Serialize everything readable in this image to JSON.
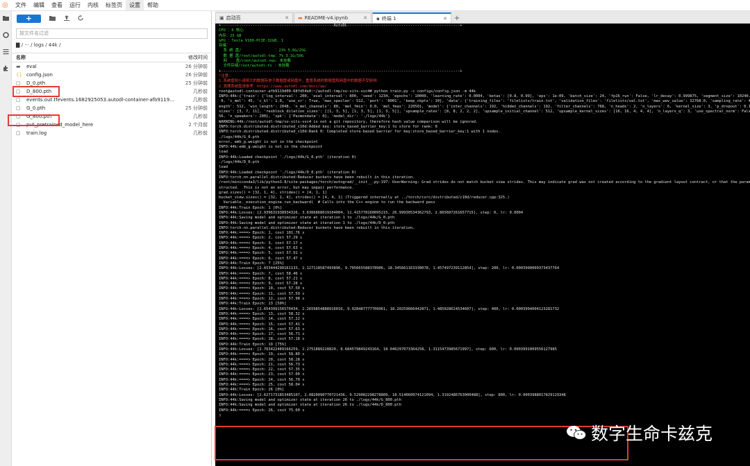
{
  "menubar": {
    "items": [
      "文件",
      "编辑",
      "查看",
      "运行",
      "内核",
      "标签页",
      "设置",
      "帮助"
    ],
    "active": "设置"
  },
  "filebrowser": {
    "search_placeholder": "按文件名过滤",
    "breadcrumb": "▇ / ··· / logs / 44k /",
    "col_name": "名称",
    "col_modified": "修改时间",
    "files": [
      {
        "name": "eval",
        "modified": "26 分钟前",
        "icon": "folder"
      },
      {
        "name": "config.json",
        "modified": "26 分钟前",
        "icon": "json"
      },
      {
        "name": "D_0.pth",
        "modified": "25 分钟前",
        "icon": "file"
      },
      {
        "name": "D_800.pth",
        "modified": "几秒前",
        "icon": "file"
      },
      {
        "name": "events.out.tfevents.1682925053.autodl-container-afb9119d00-...",
        "modified": "几秒前",
        "icon": "file"
      },
      {
        "name": "G_0.pth",
        "modified": "25 分钟前",
        "icon": "file"
      },
      {
        "name": "G_800.pth",
        "modified": "几秒前",
        "icon": "file"
      },
      {
        "name": "put_pretrained_model_here",
        "modified": "2 个月前",
        "icon": "file"
      },
      {
        "name": "train.log",
        "modified": "几秒前",
        "icon": "file"
      }
    ]
  },
  "tabs": [
    {
      "label": "启动页",
      "active": false
    },
    {
      "label": "README-v4.ipynb",
      "active": false
    },
    {
      "label": "终端 1",
      "active": true
    }
  ],
  "terminal": {
    "lines": [
      {
        "t": "+--------------------------------------------------AutoDL--------------------------------------------------+",
        "c": ""
      },
      {
        "t": "CPU ：6 核心",
        "c": "g"
      },
      {
        "t": "内存：25 GB",
        "c": "g"
      },
      {
        "t": "GPU ：Tesla V100-PCIE-32GB, 1",
        "c": "g"
      },
      {
        "t": "存储：",
        "c": "g"
      },
      {
        "t": "  系 统 盘/               ：23% 5.6G/25G",
        "c": "g"
      },
      {
        "t": "  数 据 盘/root/autodl-tmp：7% 3.1G/50G",
        "c": "g"
      },
      {
        "t": "  网    盘/root/autodl-nas：未挂载",
        "c": "g"
      },
      {
        "t": "  文件存储/root/autodl-fs ：未挂载",
        "c": "g"
      },
      {
        "t": "+----------------------------------------------------------------------------------------------------------+",
        "c": ""
      },
      {
        "t": "*注意：",
        "c": "r"
      },
      {
        "t": "1.系统盘较小请将大的数据存放于数据盘或网盘中，重置系统时数据盘和网盘中的数据不受影响",
        "c": "r"
      },
      {
        "t": "2.清理系统盘请参考：https://www.autodl.com/docs/qa/",
        "c": "r"
      },
      {
        "t": "root@autodl-container-afb9119d00-68fd54e0:~/autodl-tmp/so-vits-svc4# python train.py -c configs/config.json -m 44k",
        "c": ""
      },
      {
        "t": "INFO:44k:{'train': {'log_interval': 200, 'eval_interval': 800, 'seed': 1234, 'epochs': 10000, 'learning_rate': 0.0004, 'betas': [0.8, 0.99], 'eps': 1e-09, 'batch_size': 24, 'fp16_run': False, 'lr_decay': 0.999875, 'segment_size': 10240, 'init_lr_ratio': 1, 'warmup_epochs': 0, 'c_mel': 45, 'c_kl': 1.0,",
        "c": ""
      },
      {
        "t": " 0, 'c_mel': 45, 'c_kl': 1.0, 'use_sr': True, 'max_speclen': 512, 'port': '8001', 'keep_ckpts': 10}, 'data': {'training_files': 'filelists/train.txt', 'validation_files': 'filelists/val.txt', 'max_wav_value': 32768.0, 'sampling_rate': 44100, 'filter_length': 2048, 'hop_length': 512, 'win_l",
        "c": ""
      },
      {
        "t": "ength': 512, 'win_length': 2048, 'n_mel_channels': 80, 'mel_fmin': 0.0, 'mel_fmax': 22050}, 'model': {'inter_channels': 192, 'hidden_channels': 192, 'filter_channels': 768, 'n_heads': 2, 'n_layers': 6, 'kernel_size': 3, 'p_dropout': 0.1, 'resblock': '1', 'resblock_kernel_",
        "c": ""
      },
      {
        "t": "sizes': [3, 7, 11], 'resblock_dilation_sizes': [[1, 3, 5], [1, 3, 5], [1, 3, 5]], 'upsample_rates': [8, 8, 2, 2, 2], 'upsample_initial_channel': 512, 'upsample_kernel_sizes': [16, 16, 4, 4, 4], 'n_layers_q': 3, 'use_spectral_norm': False, 'gin_channels': 2",
        "c": ""
      },
      {
        "t": "56, 'n_speakers': 200}, 'spk': {'Paimondata': 0}, 'model_dir': './logs/44k'}",
        "c": ""
      },
      {
        "t": "WARNING:44k:/root/autodl-tmp/so-vits-svc4 is not a git repository, therefore hash value comparison will be ignored.",
        "c": ""
      },
      {
        "t": "INFO:torch.distributed.distributed_c10d:Added key: store_based_barrier_key:1 to store for rank: 0",
        "c": ""
      },
      {
        "t": "INFO:torch.distributed.distributed_c10d:Rank 0: Completed store-based barrier for key:store_based_barrier_key:1 with 1 nodes.",
        "c": ""
      },
      {
        "t": "./logs/44k/G_0.pth",
        "c": ""
      },
      {
        "t": "error, emb_g.weight is not in the checkpoint",
        "c": ""
      },
      {
        "t": "INFO:44k:emb_g.weight is not in the checkpoint",
        "c": ""
      },
      {
        "t": "load",
        "c": ""
      },
      {
        "t": "INFO:44k:Loaded checkpoint './logs/44k/G_0.pth' (iteration 0)",
        "c": ""
      },
      {
        "t": "./logs/44k/D_0.pth",
        "c": ""
      },
      {
        "t": "load",
        "c": ""
      },
      {
        "t": "INFO:44k:Loaded checkpoint './logs/44k/D_0.pth' (iteration 0)",
        "c": ""
      },
      {
        "t": "INFO:torch.nn.parallel.distributed:Reducer buckets have been rebuilt in this iteration.",
        "c": ""
      },
      {
        "t": "/root/miniconda3/lib/python3.8/site-packages/torch/autograd/__init__.py:197: UserWarning: Grad strides do not match bucket view strides. This may indicate grad was not created according to the gradient layout contract, or that the param's strides changed since DDP was con",
        "c": ""
      },
      {
        "t": "structed.  This is not an error, but may impair performance.",
        "c": ""
      },
      {
        "t": "grad.sizes() = [32, 1, 4], strides() = [4, 1, 1]",
        "c": ""
      },
      {
        "t": "bucket_view.sizes() = [32, 1, 4], strides() = [4, 4, 1] (Triggered internally at ../torch/csrc/distributed/c10d/reducer.cpp:325.)",
        "c": ""
      },
      {
        "t": "  Variable._execution_engine.run_backward(  # Calls into the C++ engine to run the backward pass",
        "c": ""
      },
      {
        "t": "INFO:44k:Train Epoch: 1 [0%]",
        "c": ""
      },
      {
        "t": "INFO:44k:Losses: [2.939631938934326, 3.6366868019104004, 11.415778160095215, 26.99930534362793, 2.865607261657715], step: 0, lr: 0.0004",
        "c": ""
      },
      {
        "t": "INFO:44k:Saving model and optimizer state at iteration 1 to ./logs/44k/G_0.pth",
        "c": ""
      },
      {
        "t": "INFO:44k:Saving model and optimizer state at iteration 1 to ./logs/44k/D_0.pth",
        "c": ""
      },
      {
        "t": "INFO:torch.nn.parallel.distributed:Reducer buckets have been rebuilt in this iteration.",
        "c": ""
      },
      {
        "t": "INFO:44k:====> Epoch: 1, cost 101.76 s",
        "c": ""
      },
      {
        "t": "INFO:44k:====> Epoch: 2, cost 57.29 s",
        "c": ""
      },
      {
        "t": "INFO:44k:====> Epoch: 3, cost 57.17 s",
        "c": ""
      },
      {
        "t": "INFO:44k:====> Epoch: 4, cost 57.63 s",
        "c": ""
      },
      {
        "t": "INFO:44k:====> Epoch: 5, cost 57.91 s",
        "c": ""
      },
      {
        "t": "INFO:44k:====> Epoch: 6, cost 57.47 s",
        "c": ""
      },
      {
        "t": "INFO:44k:Train Epoch: 7 [25%]",
        "c": ""
      },
      {
        "t": "INFO:44k:Losses: [2.653444290161133, 2.127118587493896, 9.705665588378906, 18.345661163330078, 1.457497239112854], step: 200, lr: 0.0003990009373437764",
        "c": ""
      },
      {
        "t": "INFO:44k:====> Epoch: 7, cost 58.46 s",
        "c": ""
      },
      {
        "t": "INFO:44k:====> Epoch: 8, cost 57.21 s",
        "c": ""
      },
      {
        "t": "INFO:44k:====> Epoch: 9, cost 57.28 s",
        "c": ""
      },
      {
        "t": "INFO:44k:====> Epoch: 10, cost 57.50 s",
        "c": ""
      },
      {
        "t": "INFO:44k:====> Epoch: 11, cost 57.59 s",
        "c": ""
      },
      {
        "t": "INFO:44k:====> Epoch: 12, cost 57.98 s",
        "c": ""
      },
      {
        "t": "INFO:44k:Train Epoch: 13 [50%]",
        "c": ""
      },
      {
        "t": "INFO:44k:Losses: [2.654399156570434, 2.2659854888916016, 9.928487777709961, 18.20259666442871, 1.485028624534607], step: 400, lr: 0.0003994004123281732",
        "c": ""
      },
      {
        "t": "INFO:44k:====> Epoch: 13, cost 58.32 s",
        "c": ""
      },
      {
        "t": "INFO:44k:====> Epoch: 14, cost 57.22 s",
        "c": ""
      },
      {
        "t": "INFO:44k:====> Epoch: 15, cost 57.41 s",
        "c": ""
      },
      {
        "t": "INFO:44k:====> Epoch: 16, cost 57.63 s",
        "c": ""
      },
      {
        "t": "INFO:44k:====> Epoch: 17, cost 56.71 s",
        "c": ""
      },
      {
        "t": "INFO:44k:====> Epoch: 18, cost 57.18 s",
        "c": ""
      },
      {
        "t": "INFO:44k:Train Epoch: 19 [75%]",
        "c": ""
      },
      {
        "t": "INFO:44k:Losses: [2.763422489166259, 2.2751889228820, 8.684579849243164, 18.046297073364258, 1.3115473985671997], step: 600, lr: 0.0003991009556127985",
        "c": ""
      },
      {
        "t": "INFO:44k:====> Epoch: 19, cost 58.80 s",
        "c": ""
      },
      {
        "t": "INFO:44k:====> Epoch: 20, cost 58.28 s",
        "c": ""
      },
      {
        "t": "INFO:44k:====> Epoch: 21, cost 56.73 s",
        "c": ""
      },
      {
        "t": "INFO:44k:====> Epoch: 22, cost 57.35 s",
        "c": ""
      },
      {
        "t": "INFO:44k:====> Epoch: 23, cost 57.00 s",
        "c": ""
      },
      {
        "t": "INFO:44k:====> Epoch: 24, cost 56.70 s",
        "c": ""
      },
      {
        "t": "INFO:44k:====> Epoch: 25, cost 58.04 s",
        "c": ""
      },
      {
        "t": "INFO:44k:Train Epoch: 26 [0%]",
        "c": ""
      },
      {
        "t": "INFO:44k:Losses: [2.6271731853485107, 2.0820090770721436, 9.529082298278809, 18.514060974121094, 1.3192486763000488], step: 800, lr: 0.0003988017829129348",
        "c": ""
      },
      {
        "t": "INFO:44k:Saving model and optimizer state at iteration 26 to ./logs/44k/G_800.pth",
        "c": ""
      },
      {
        "t": "INFO:44k:Saving model and optimizer state at iteration 26 to ./logs/44k/D_800.pth",
        "c": ""
      },
      {
        "t": "INFO:44k:====> Epoch: 26, cost 75.60 s",
        "c": ""
      },
      {
        "t": "▯",
        "c": ""
      }
    ]
  },
  "watermark": {
    "text": "数字生命卡兹克"
  }
}
